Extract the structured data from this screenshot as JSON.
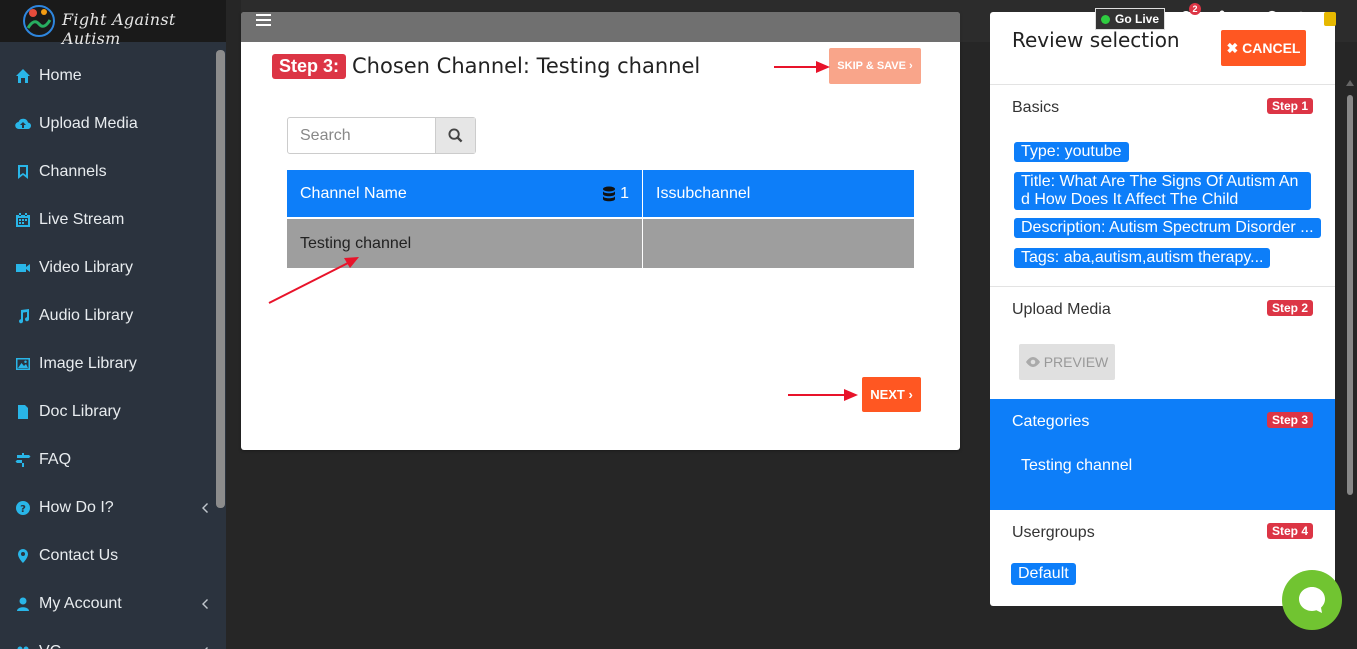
{
  "app": {
    "logo_text": "Fight Against Autism"
  },
  "sidebar": {
    "items": [
      {
        "label": "Home",
        "icon": "home-icon"
      },
      {
        "label": "Upload Media",
        "icon": "cloud-upload-icon"
      },
      {
        "label": "Channels",
        "icon": "bookmark-icon"
      },
      {
        "label": "Live Stream",
        "icon": "calendar-icon"
      },
      {
        "label": "Video Library",
        "icon": "video-camera-icon"
      },
      {
        "label": "Audio Library",
        "icon": "music-note-icon"
      },
      {
        "label": "Image Library",
        "icon": "image-icon"
      },
      {
        "label": "Doc Library",
        "icon": "document-icon"
      },
      {
        "label": "FAQ",
        "icon": "signpost-icon"
      },
      {
        "label": "How Do I?",
        "icon": "question-circle-icon"
      },
      {
        "label": "Contact Us",
        "icon": "map-marker-icon"
      },
      {
        "label": "My Account",
        "icon": "user-icon"
      },
      {
        "label": "VC",
        "icon": "group-icon"
      }
    ]
  },
  "topbar": {
    "go_live": "Go Live",
    "notification_count": "2"
  },
  "main": {
    "step_badge": "Step 3:",
    "step_title": "Chosen Channel: Testing channel",
    "skip_save": "SKIP & SAVE ›",
    "search_placeholder": "Search",
    "table": {
      "headers": [
        "Channel Name",
        "Issubchannel"
      ],
      "header_count": "1",
      "rows": [
        [
          "Testing channel",
          ""
        ]
      ]
    },
    "next": "NEXT ›"
  },
  "review": {
    "title": "Review selection",
    "cancel": "✖ CANCEL",
    "basics": {
      "title": "Basics",
      "badge": "Step 1",
      "tags": [
        "Type: youtube",
        "Title: What Are The Signs Of Autism An",
        "d How Does It Affect The Child",
        "Description: Autism Spectrum Disorder ...",
        "Tags: aba,autism,autism therapy..."
      ]
    },
    "upload": {
      "title": "Upload Media",
      "badge": "Step 2",
      "preview": "PREVIEW"
    },
    "categories": {
      "title": "Categories",
      "badge": "Step 3",
      "value": "Testing channel"
    },
    "usergroups": {
      "title": "Usergroups",
      "badge": "Step 4",
      "value": "Default"
    }
  },
  "colors": {
    "primary": "#0d7ef9",
    "danger": "#dc3545",
    "accent": "#ff5722",
    "sidebar": "#2b333e",
    "icon": "#29b6e8",
    "chat": "#71c431"
  }
}
